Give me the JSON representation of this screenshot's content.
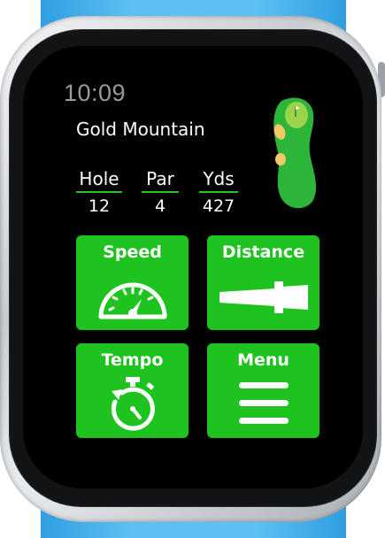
{
  "status": {
    "time": "10:09"
  },
  "course": {
    "name": "Gold Mountain"
  },
  "stats": [
    {
      "label": "Hole",
      "value": "12"
    },
    {
      "label": "Par",
      "value": "4"
    },
    {
      "label": "Yds",
      "value": "427"
    }
  ],
  "tiles": [
    {
      "label": "Speed",
      "icon": "speedometer-icon"
    },
    {
      "label": "Distance",
      "icon": "putter-icon"
    },
    {
      "label": "Tempo",
      "icon": "stopwatch-icon"
    },
    {
      "label": "Menu",
      "icon": "hamburger-menu-icon"
    }
  ],
  "colors": {
    "accent": "#1fc31f",
    "band": "#4fb4ea",
    "screen_bg": "#000000",
    "time_text": "#9a9a9a",
    "fairway": "#2db53a",
    "green": "#9ad44a",
    "sand": "#f4c86a"
  }
}
